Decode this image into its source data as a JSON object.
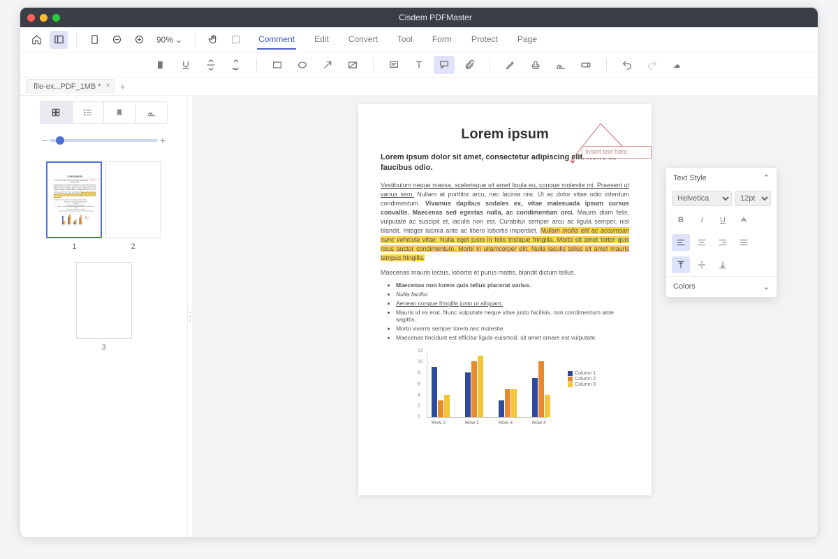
{
  "app": {
    "title": "Cisdem PDFMaster"
  },
  "toolbar": {
    "zoom": "90%",
    "tabs": [
      "Comment",
      "Edit",
      "Convert",
      "Tool",
      "Form",
      "Protect",
      "Page"
    ],
    "activeTab": "Comment"
  },
  "filetab": {
    "name": "file-ex...PDF_1MB *"
  },
  "thumbs": {
    "pages": [
      "1",
      "2",
      "3"
    ],
    "selected": 0
  },
  "annotation": {
    "placeholder": "Insert text here"
  },
  "stylePanel": {
    "title": "Text Style",
    "font": "Helvetica",
    "size": "12pt",
    "colorsLabel": "Colors"
  },
  "doc": {
    "title": "Lorem ipsum",
    "subtitle": "Lorem ipsum dolor sit amet, consectetur adipiscing elit. Nunc ac faucibus odio.",
    "para1a": "Vestibulum neque massa, scelerisque sit amet ligula eu, congue molestie mi. Praesent ut varius sem.",
    "para1b": " Nullam at porttitor arcu, nec lacinia nisi. Ut ac dolor vitae odio interdum condimentum. ",
    "para1c": "Vivamus dapibus sodales ex, vitae malesuada ipsum cursus convallis. Maecenas sed egestas nulla, ac condimentum orci.",
    "para1d": " Mauris diam felis, vulputate ac suscipit et, iaculis non est. Curabitur semper arcu ac ligula semper, nisl blandit. Integer lacinia ante ac libero lobortis imperdiet. ",
    "para1e": "Nullam mollis elit ac accumsan nunc vehicula vitae.",
    "para1f": " Nulla eget justo in felis tristique fringilla. Morbi sit amet tortor quis risus auctor condimentum. Morbi in ullamcorper elit. Nulla iaculis tellus sit amet mauris tempus fringilla.",
    "para2": "Maecenas mauris lectus, lobortis et purus mattis, blandit dictum tellus.",
    "bullets": [
      "Maecenas non lorem quis tellus placerat varius.",
      "Nulla facilisi.",
      "Aenean congue fringilla justo ut aliquam.",
      "Mauris id ex erat. Nunc vulputate neque vitae justo facilisis, non condimentum ante sagittis.",
      "Morbi viverra semper lorem nec molestie.",
      "Maecenas tincidunt est efficitur ligula euismod, sit amet ornare est vulputate."
    ]
  },
  "chart_data": {
    "type": "bar",
    "title": "",
    "xlabel": "",
    "ylabel": "",
    "ylim": [
      0,
      12
    ],
    "yticks": [
      0,
      2,
      4,
      6,
      8,
      10,
      12
    ],
    "categories": [
      "Row 1",
      "Row 2",
      "Row 3",
      "Row 4"
    ],
    "series": [
      {
        "name": "Column 1",
        "color": "#2d4a9c",
        "values": [
          9,
          8,
          3,
          7
        ]
      },
      {
        "name": "Column 2",
        "color": "#e58a2f",
        "values": [
          3,
          10,
          5,
          10
        ]
      },
      {
        "name": "Column 3",
        "color": "#f2c53d",
        "values": [
          4,
          11,
          5,
          4
        ]
      }
    ]
  }
}
